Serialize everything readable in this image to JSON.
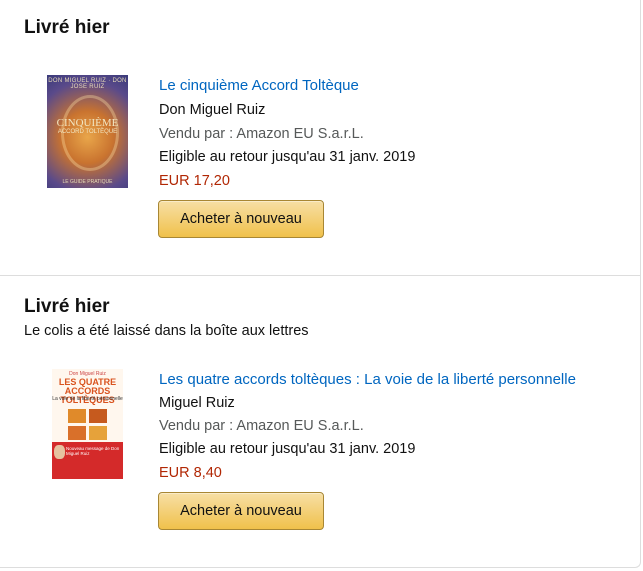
{
  "orders": [
    {
      "status": "Livré hier",
      "note": "",
      "title": "Le cinquième Accord Toltèque",
      "author": "Don Miguel Ruiz",
      "seller": "Vendu par : Amazon EU S.a.r.L.",
      "return": "Eligible au retour jusqu'au 31 janv. 2019",
      "price": "EUR 17,20",
      "button": "Acheter à nouveau",
      "cover": {
        "line1": "DON MIGUEL RUIZ · DON JOSE RUIZ",
        "line2": "CINQUIÈME",
        "line3": "ACCORD TOLTÈQUE",
        "line4": "LE GUIDE PRATIQUE"
      }
    },
    {
      "status": "Livré hier",
      "note": "Le colis a été laissé dans la boîte aux lettres",
      "title": "Les quatre accords toltèques : La voie de la liberté personnelle",
      "author": "Miguel Ruiz",
      "seller": "Vendu par : Amazon EU S.a.r.L.",
      "return": "Eligible au retour jusqu'au 31 janv. 2019",
      "price": "EUR 8,40",
      "button": "Acheter à nouveau",
      "cover": {
        "line1": "Don Miguel Ruiz",
        "line2": "LES QUATRE ACCORDS TOLTÈQUES",
        "line3": "La voie de la liberté personnelle",
        "line4": "Nouveau message de Don Miguel Ruiz"
      }
    }
  ],
  "colors": {
    "link": "#0066c0",
    "price": "#b12704",
    "button_top": "#f7dfa5",
    "button_bottom": "#f0c14b"
  }
}
